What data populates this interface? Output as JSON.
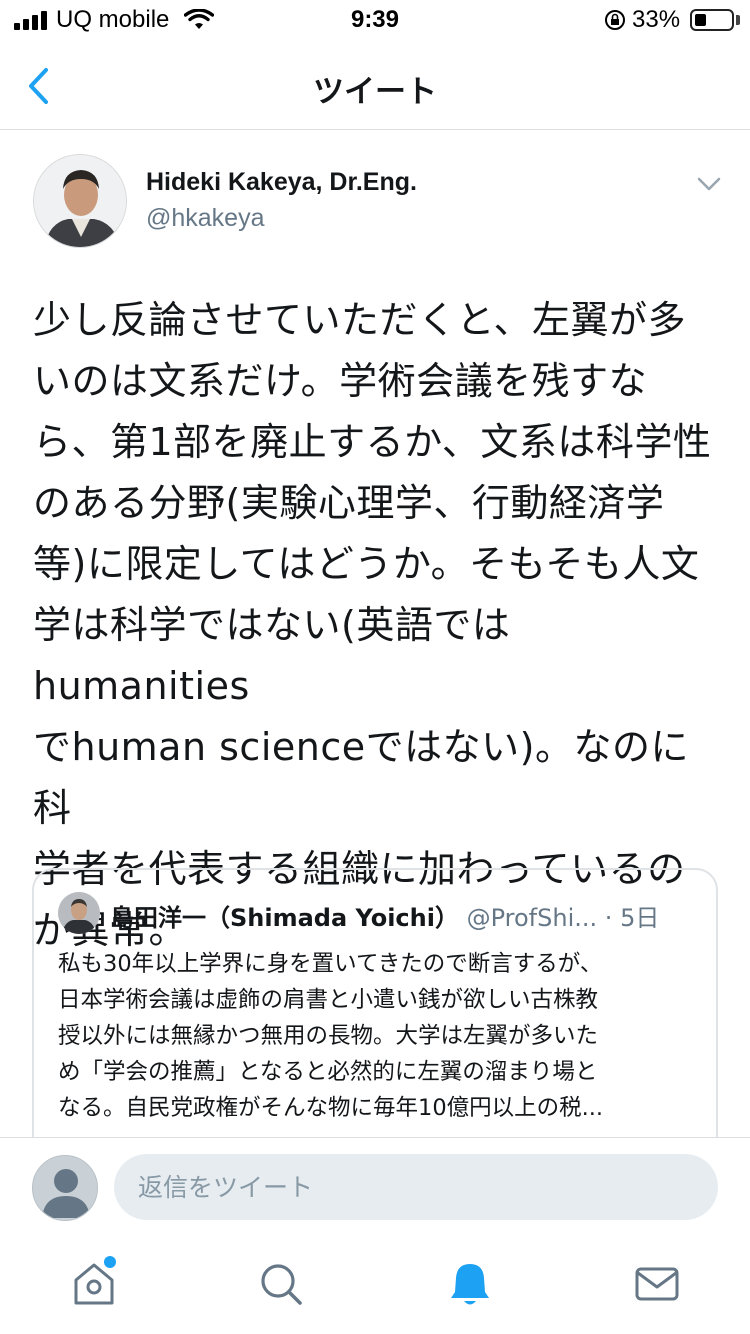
{
  "status_bar": {
    "carrier": "UQ mobile",
    "time": "9:39",
    "battery_percent": "33%",
    "battery_level": 0.33
  },
  "nav": {
    "title": "ツイート"
  },
  "tweet": {
    "author_name": "Hideki Kakeya, Dr.Eng.",
    "author_handle": "@hkakeya",
    "text_lines": [
      "少し反論させていただくと、左翼が多",
      "いのは文系だけ。学術会議を残すな",
      "ら、第1部を廃止するか、文系は科学性",
      "のある分野(実験心理学、行動経済学",
      "等)に限定してはどうか。そもそも人文",
      "学は科学ではない(英語ではhumanities",
      "でhuman scienceではない)。なのに科",
      "学者を代表する組織に加わっているの",
      "が異常。"
    ]
  },
  "quoted_tweet": {
    "author_name": "島田洋一（Shimada Yoichi）",
    "author_handle": "@ProfShi...",
    "separator": "·",
    "time": "5日",
    "text_lines": [
      "私も30年以上学界に身を置いてきたので断言するが、",
      "日本学術会議は虚飾の肩書と小遣い銭が欲しい古株教",
      "授以外には無縁かつ無用の長物。大学は左翼が多いた",
      "め「学会の推薦」となると必然的に左翼の溜まり場と",
      "なる。自民党政権がそんな物に毎年10億円以上の税..."
    ]
  },
  "reply": {
    "placeholder": "返信をツイート"
  },
  "tabbar": {
    "items": [
      "home",
      "search",
      "notifications",
      "messages"
    ],
    "active": "notifications",
    "home_has_new": true
  },
  "colors": {
    "accent": "#1da1f2",
    "secondary_text": "#657786",
    "icon_gray": "#657786"
  }
}
